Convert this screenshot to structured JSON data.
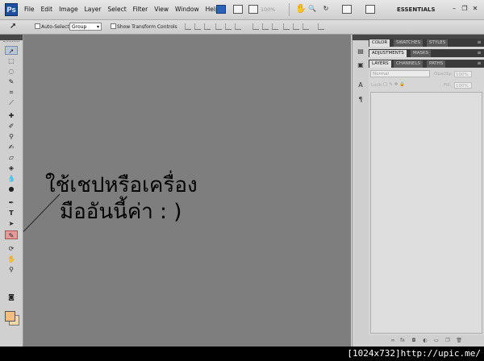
{
  "app": {
    "logo": "Ps"
  },
  "menu": [
    "File",
    "Edit",
    "Image",
    "Layer",
    "Select",
    "Filter",
    "View",
    "Window",
    "Help"
  ],
  "menubar": {
    "zoom": "100%",
    "workspace": "ESSENTIALS"
  },
  "options": {
    "auto_select_label": "Auto-Select:",
    "auto_select_value": "Group",
    "show_transform_label": "Show Transform Controls"
  },
  "annotation": {
    "line1": "ใช้เชปหรือเครื่อง",
    "line2": "มืออันนี้ค่า : )"
  },
  "panels": {
    "group1_tabs": [
      "COLOR",
      "SWATCHES",
      "STYLES"
    ],
    "group2_tabs": [
      "ADJUSTMENTS",
      "MASKS"
    ],
    "group3_tabs": [
      "LAYERS",
      "CHANNELS",
      "PATHS"
    ],
    "blend_mode": "Normal",
    "opacity_label": "Opacity:",
    "opacity_value": "100%",
    "lock_label": "Lock:",
    "fill_label": "Fill:",
    "fill_value": "100%"
  },
  "credit": "[1024x732]http://upic.me/",
  "colors": {
    "foreground": "#f7be82",
    "background": "#f8d6a6",
    "canvas": "#7e7e7e"
  }
}
